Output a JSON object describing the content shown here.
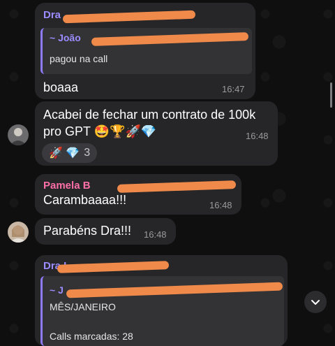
{
  "colors": {
    "accent": "#9b8cff",
    "pink": "#ff6fa8",
    "redaction": "#f08a4b"
  },
  "messages": [
    {
      "sender": "Dra",
      "quote": {
        "name": "~ João",
        "text": "pagou na call"
      },
      "text": "boaaa",
      "time": "16:47"
    },
    {
      "text_line1": "Acabei de fechar um contrato de 100k",
      "text_line2": "pro GPT 🤩🏆🚀💎",
      "time": "16:48",
      "reactions": {
        "emojis": "🚀 💎",
        "count": "3"
      }
    },
    {
      "sender": "Pamela B",
      "text": "Carambaaaa!!!",
      "time": "16:48"
    },
    {
      "text": "Parabéns Dra!!!",
      "time": "16:48"
    },
    {
      "sender": "Dra L",
      "quote": {
        "name": "~ J",
        "text": "MÊS/JANEIRO",
        "text2": "Calls marcadas: 28"
      }
    }
  ],
  "icons": {
    "scroll_down": "chevron-down-icon"
  }
}
